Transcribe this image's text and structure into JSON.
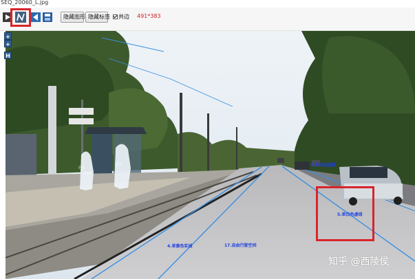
{
  "window": {
    "title": "SEQ_20060_L.jpg"
  },
  "toolbar": {
    "tools": [
      {
        "name": "play",
        "icon": "play-icon"
      },
      {
        "name": "polyline",
        "icon": "polyline-icon"
      },
      {
        "name": "undo",
        "icon": "undo-icon"
      },
      {
        "name": "save",
        "icon": "save-icon"
      }
    ],
    "hide_shape_label": "隐藏图形",
    "hide_tag_label": "隐藏标签",
    "shared_edge_label": "共边",
    "shared_edge_checked": true,
    "cursor_coords": "491*383"
  },
  "side_controls": {
    "expand": "+",
    "add": "+",
    "h": "H"
  },
  "annotations": {
    "lane_label_1": "5.单白色虚线",
    "lane_label_2": "5.单白色虚线",
    "lane_label_3": "4.单黄色实线",
    "lane_label_4": "17.自由行驶空间",
    "pedestrian_1": "行人",
    "pedestrian_2": "行人"
  },
  "colors": {
    "highlight": "#d9242a",
    "lane_line": "#3a8fe0",
    "label_text": "#1e3fe0",
    "coords_text": "#cc1f1f"
  },
  "watermark": "知乎 @西陵侯"
}
